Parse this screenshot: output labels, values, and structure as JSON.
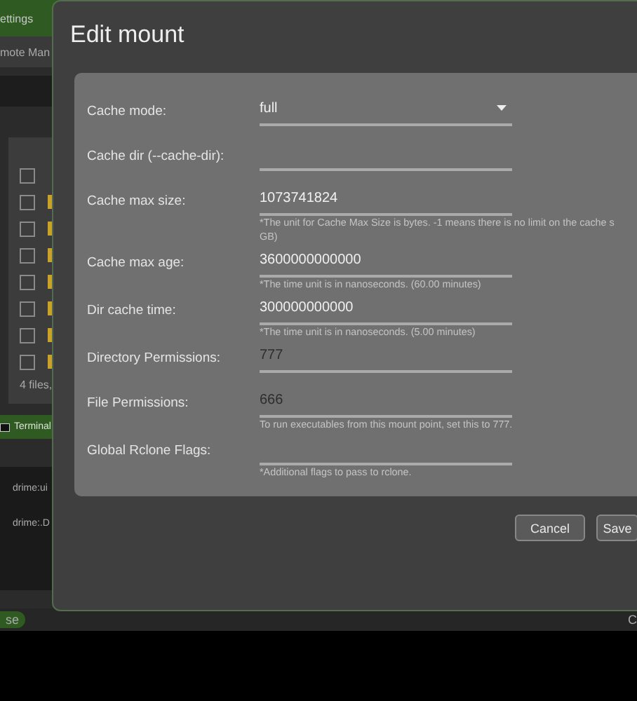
{
  "background_app": {
    "menu_item": "ettings",
    "tab": "mote Man",
    "header_row": {
      "checked": false
    },
    "file_rows": [
      {
        "checked": false
      },
      {
        "checked": false
      },
      {
        "checked": false
      },
      {
        "checked": false
      },
      {
        "checked": false
      },
      {
        "checked": false
      },
      {
        "checked": false
      }
    ],
    "file_count": "4 files,",
    "terminal_tab": "Terminal",
    "terminal_lines": [
      "drime:ui",
      "drime:.D"
    ],
    "status_button": "se",
    "status_text": "C"
  },
  "dialog": {
    "title": "Edit mount",
    "fields": [
      {
        "kind": "select",
        "label": "Cache mode:",
        "value": "full"
      },
      {
        "kind": "text",
        "label": "Cache dir (--cache-dir):"
      },
      {
        "kind": "text",
        "label": "Cache max size:",
        "value": "1073741824",
        "hint_lines": [
          "*The unit for Cache Max Size is bytes. -1 means there is no limit on the cache s",
          "GB)"
        ]
      },
      {
        "kind": "text",
        "label": "Cache max age:",
        "value": "3600000000000",
        "hint_lines": [
          "*The time unit is in nanoseconds. (60.00 minutes)"
        ]
      },
      {
        "kind": "text",
        "label": "Dir cache time:",
        "value": "300000000000",
        "hint_lines": [
          "*The time unit is in nanoseconds. (5.00 minutes)"
        ]
      },
      {
        "kind": "text",
        "label": "Directory Permissions:",
        "value": "777"
      },
      {
        "kind": "text",
        "label": "File Permissions:",
        "value": "666",
        "hint_lines": [
          "To run executables from this mount point, set this to 777."
        ]
      },
      {
        "kind": "text",
        "label": "Global Rclone Flags:",
        "hint_lines": [
          "*Additional flags to pass to rclone."
        ]
      }
    ],
    "buttons": [
      "Cancel",
      "Save"
    ]
  }
}
